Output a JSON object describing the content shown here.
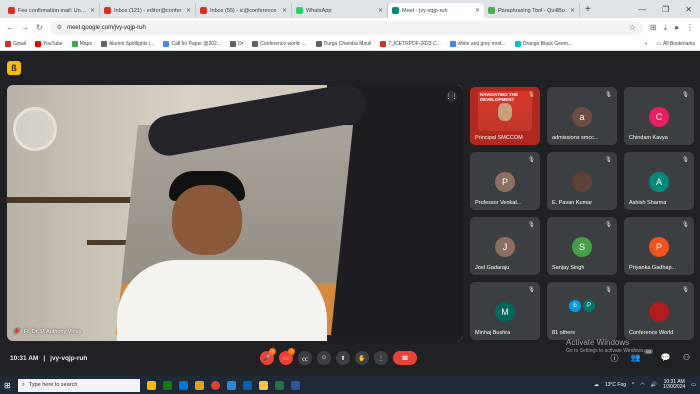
{
  "browser": {
    "tabs": [
      {
        "label": "Fee confirmation mail: Unive",
        "fav_color": "#d93025"
      },
      {
        "label": "Inbox (121) - editor@confer",
        "fav_color": "#d93025"
      },
      {
        "label": "Inbox (55) - ic@conference",
        "fav_color": "#d93025"
      },
      {
        "label": "WhatsApp",
        "fav_color": "#25d366"
      },
      {
        "label": "Meet - jvy-vqjp-ruh",
        "fav_color": "#00897b"
      },
      {
        "label": "Paraphrasing Tool - QuillBo",
        "fav_color": "#4caf50"
      }
    ],
    "new_tab": "+",
    "url": "meet.google.com/jvy-vqjp-ruh",
    "bookmarks": [
      {
        "label": "Gmail",
        "color": "#d93025"
      },
      {
        "label": "YouTube",
        "color": "#ff0000"
      },
      {
        "label": "Maps",
        "color": "#34a853"
      },
      {
        "label": "Alumni Spotlights |...",
        "color": "#5f6368"
      },
      {
        "label": "Call for Paper @202...",
        "color": "#4285f4"
      },
      {
        "label": "Dr",
        "color": "#5f6368"
      },
      {
        "label": "Conference world -...",
        "color": "#5f6368"
      },
      {
        "label": "Durga Chandra Mouli",
        "color": "#5f6368"
      },
      {
        "label": "7_ICETRPDF-2023 C...",
        "color": "#d93025"
      },
      {
        "label": "white and grey mod...",
        "color": "#4285f4"
      },
      {
        "label": "Orange Black Geom...",
        "color": "#00c4cc"
      }
    ],
    "bookmarks_more": "»",
    "all_bookmarks": "All Bookmarks"
  },
  "meet": {
    "logo": "ß",
    "main_speaker": "Fr. Dr. P. Anthony Vinay",
    "tiles": [
      {
        "name": "Principal SMCCOM",
        "avatar": "",
        "color": "#b0281e",
        "banner": "NAVIGATING THE DEVELOPMENT"
      },
      {
        "name": "admissions smcc...",
        "avatar": "a",
        "color": "#6d4c41"
      },
      {
        "name": "Chindam Kavya",
        "avatar": "C",
        "color": "#e91e63"
      },
      {
        "name": "Professor Venkat...",
        "avatar": "P",
        "color": "#8d6e63"
      },
      {
        "name": "E. Pavan Kumar",
        "avatar": "",
        "color": "#5d4037"
      },
      {
        "name": "Ashish Sharma",
        "avatar": "A",
        "color": "#00897b"
      },
      {
        "name": "Joel Gadaraju",
        "avatar": "J",
        "color": "#8d6e63"
      },
      {
        "name": "Sanjay Singh",
        "avatar": "S",
        "color": "#43a047"
      },
      {
        "name": "Priyanka Gadhap...",
        "avatar": "P",
        "color": "#f4511e"
      },
      {
        "name": "Minhaj Bushra",
        "avatar": "M",
        "color": "#00695c"
      },
      {
        "name": "81 others",
        "avatar": "",
        "color": "#3c4043",
        "pair": [
          "b",
          "P"
        ]
      },
      {
        "name": "Conference World",
        "avatar": "",
        "color": "#b71c1c"
      }
    ],
    "time": "10:31 AM",
    "separator": "|",
    "meeting_code": "jvy-vqjp-ruh",
    "participants_count": "93",
    "activate_title": "Activate Windows",
    "activate_sub": "Go to Settings to activate Windows."
  },
  "taskbar": {
    "search_placeholder": "Type here to search",
    "weather": "13°C  Fog",
    "clock_time": "10:31 AM",
    "clock_date": "1/30/2024"
  }
}
